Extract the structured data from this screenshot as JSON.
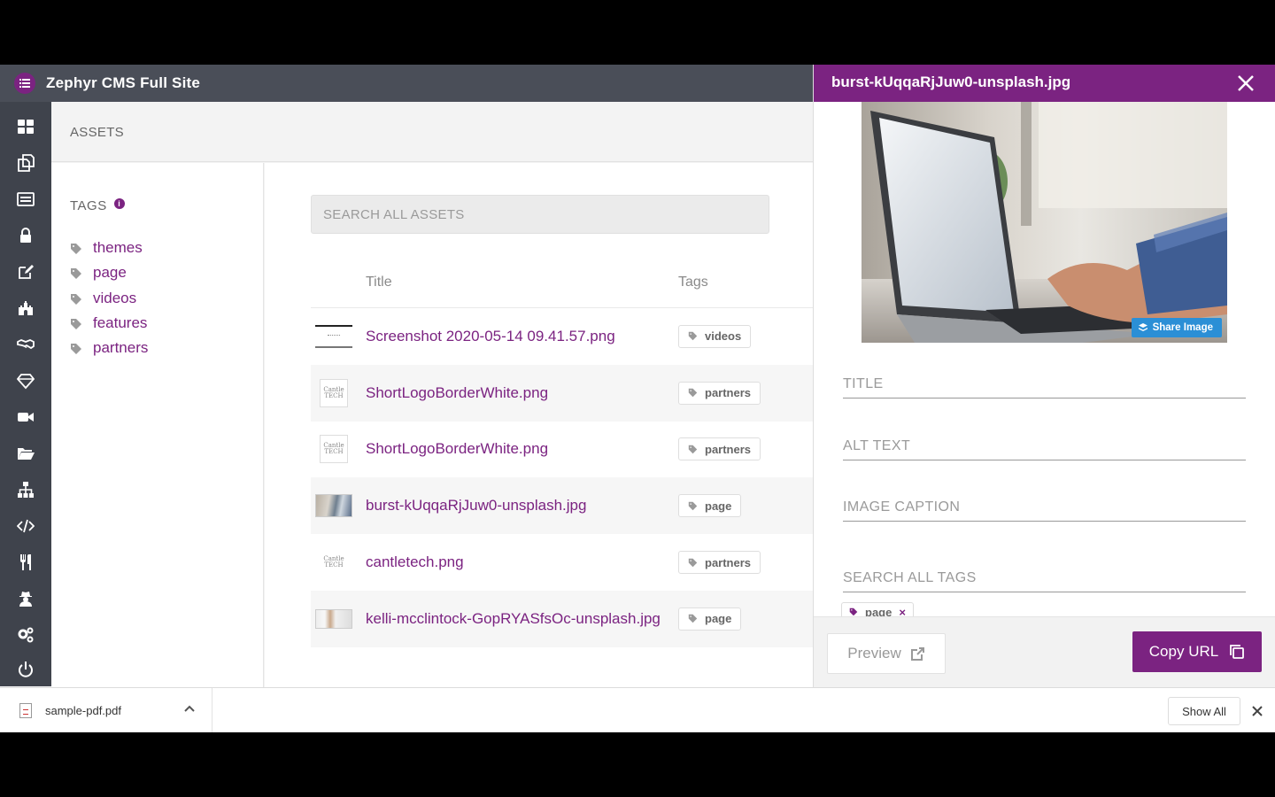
{
  "app": {
    "title": "Zephyr CMS Full Site",
    "logo_icon": "list-icon",
    "accent_color": "#7b2381"
  },
  "sidebar": {
    "items": [
      {
        "icon": "dashboard-icon"
      },
      {
        "icon": "pages-icon"
      },
      {
        "icon": "content-list-icon"
      },
      {
        "icon": "lock-icon"
      },
      {
        "icon": "edit-icon"
      },
      {
        "icon": "castle-icon"
      },
      {
        "icon": "handshake-icon"
      },
      {
        "icon": "diamond-icon"
      },
      {
        "icon": "video-icon"
      },
      {
        "icon": "folder-open-icon"
      },
      {
        "icon": "sitemap-icon"
      },
      {
        "icon": "code-icon"
      },
      {
        "icon": "utensils-icon"
      },
      {
        "icon": "user-secret-icon"
      },
      {
        "icon": "settings-icon"
      },
      {
        "icon": "power-icon"
      }
    ]
  },
  "breadcrumb": "ASSETS",
  "tags_panel": {
    "heading": "TAGS",
    "tags": [
      "themes",
      "page",
      "videos",
      "features",
      "partners"
    ]
  },
  "assets": {
    "search_placeholder": "SEARCH ALL ASSETS",
    "columns": {
      "title": "Title",
      "tags": "Tags"
    },
    "rows": [
      {
        "title": "Screenshot 2020-05-14 09.41.57.png",
        "tag": "videos",
        "thumb": "screenshot"
      },
      {
        "title": "ShortLogoBorderWhite.png",
        "tag": "partners",
        "thumb": "logo"
      },
      {
        "title": "ShortLogoBorderWhite.png",
        "tag": "partners",
        "thumb": "logo"
      },
      {
        "title": "burst-kUqqaRjJuw0-unsplash.jpg",
        "tag": "page",
        "thumb": "photo"
      },
      {
        "title": "cantletech.png",
        "tag": "partners",
        "thumb": "logo"
      },
      {
        "title": "kelli-mcclintock-GopRYASfsOc-unsplash.jpg",
        "tag": "page",
        "thumb": "photo2"
      }
    ]
  },
  "detail": {
    "title": "burst-kUqqaRjJuw0-unsplash.jpg",
    "share_label": "Share Image",
    "fields": {
      "title_placeholder": "TITLE",
      "alt_placeholder": "ALT TEXT",
      "caption_placeholder": "IMAGE CAPTION",
      "tags_placeholder": "SEARCH ALL TAGS"
    },
    "selected_tag": "page",
    "preview_label": "Preview",
    "copy_label": "Copy URL"
  },
  "download_bar": {
    "file_name": "sample-pdf.pdf",
    "show_all_label": "Show All"
  }
}
